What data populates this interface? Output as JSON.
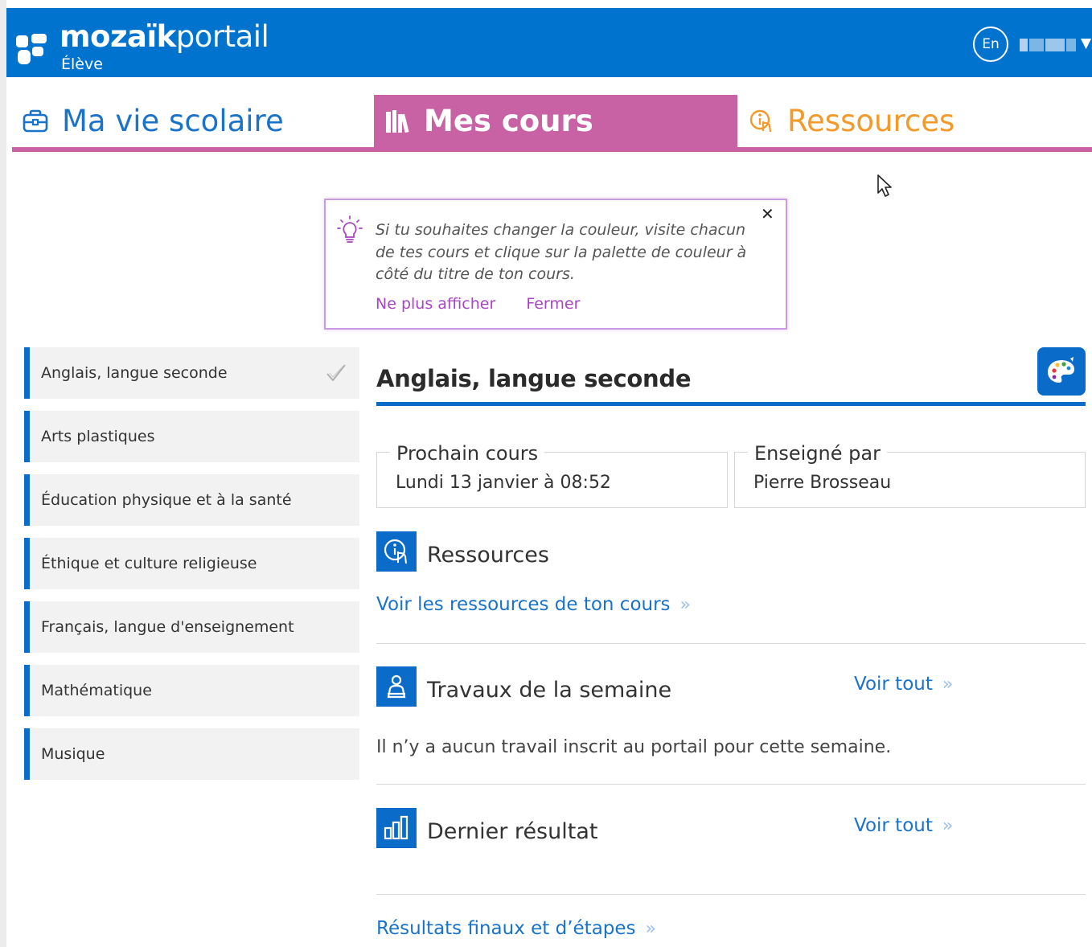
{
  "header": {
    "brand_bold": "mozaïk",
    "brand_light": "portail",
    "role": "Élève",
    "lang_label": "En",
    "colors": {
      "bar": "#0073cf",
      "accent_pink": "#c962a4",
      "accent_orange": "#f39a2b",
      "link": "#1a73c9"
    }
  },
  "tabs": [
    {
      "label": "Ma vie scolaire",
      "icon": "schoolbag-icon",
      "active": false
    },
    {
      "label": "Mes cours",
      "icon": "books-icon",
      "active": true
    },
    {
      "label": "Ressources",
      "icon": "resources-icon",
      "active": false
    }
  ],
  "tip": {
    "icon": "lightbulb-icon",
    "text": "Si tu souhaites changer la couleur, visite chacun de tes cours et clique sur la palette de couleur à côté du titre de ton cours.",
    "dont_show_label": "Ne plus afficher",
    "close_label": "Fermer",
    "close_glyph": "✕"
  },
  "courses": [
    {
      "label": "Anglais, langue seconde",
      "selected": true
    },
    {
      "label": "Arts plastiques",
      "selected": false
    },
    {
      "label": "Éducation physique et à la santé",
      "selected": false
    },
    {
      "label": "Éthique et culture religieuse",
      "selected": false
    },
    {
      "label": "Français, langue d'enseignement",
      "selected": false
    },
    {
      "label": "Mathématique",
      "selected": false
    },
    {
      "label": "Musique",
      "selected": false
    }
  ],
  "main": {
    "course_title": "Anglais, langue seconde",
    "next_class": {
      "legend": "Prochain cours",
      "value": "Lundi 13 janvier à 08:52"
    },
    "teacher": {
      "legend": "Enseigné par",
      "value": "Pierre Brosseau"
    },
    "resources": {
      "title": "Ressources",
      "link": "Voir les ressources de ton cours"
    },
    "weekly_work": {
      "title": "Travaux de la semaine",
      "see_all": "Voir tout",
      "empty_message": "Il n’y a aucun travail inscrit au portail pour cette semaine."
    },
    "last_result": {
      "title": "Dernier résultat",
      "see_all": "Voir tout"
    },
    "final_results_link": "Résultats finaux et d’étapes"
  }
}
